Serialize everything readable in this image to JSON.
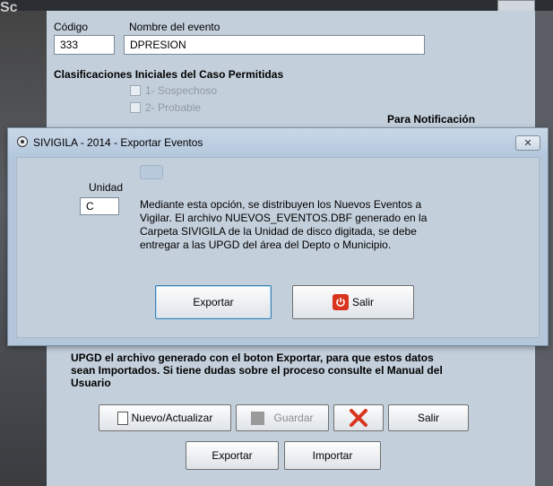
{
  "background": {
    "left_fragment": "Sc"
  },
  "form": {
    "codigo_label": "Código",
    "codigo_value": "333",
    "nombre_label": "Nombre del evento",
    "nombre_value": "DPRESION",
    "clasificaciones_heading": "Clasificaciones Iniciales del Caso Permitidas",
    "checkboxes": [
      {
        "label": "1- Sospechoso",
        "checked": false
      },
      {
        "label": "2- Probable",
        "checked": false
      }
    ],
    "para_notificacion": "Para Notificación",
    "info_text_lines": [
      "UPGD el archivo generado con el boton Exportar, para que estos datos",
      "sean Importados. Si tiene dudas sobre el proceso consulte el Manual del",
      "Usuario"
    ],
    "buttons": {
      "nuevo": "Nuevo/Actualizar",
      "guardar": "Guardar",
      "salir": "Salir",
      "exportar": "Exportar",
      "importar": "Importar"
    }
  },
  "dialog": {
    "title": "SIVIGILA - 2014 - Exportar Eventos",
    "unidad_label": "Unidad",
    "unidad_value": "C",
    "description_lines": [
      "Mediante esta opción, se distribuyen los Nuevos Eventos a",
      "Vigilar. El archivo NUEVOS_EVENTOS.DBF generado en la",
      "Carpeta SIVIGILA de la Unidad de disco digitada, se debe",
      "entregar a las UPGD del área del Depto o Municipio."
    ],
    "exportar_label": "Exportar",
    "salir_label": "Salir"
  },
  "colors": {
    "window_bg": "#c3cfdb",
    "dialog_bg": "#b4c6d9",
    "error_red": "#d9351e"
  }
}
